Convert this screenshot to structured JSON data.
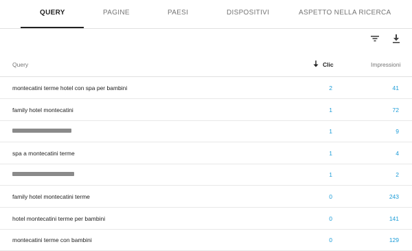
{
  "tabs": [
    {
      "label": "QUERY",
      "active": true
    },
    {
      "label": "PAGINE",
      "active": false
    },
    {
      "label": "PAESI",
      "active": false
    },
    {
      "label": "DISPOSITIVI",
      "active": false
    },
    {
      "label": "ASPETTO NELLA RICERCA",
      "active": false
    }
  ],
  "toolbar": {
    "filter_icon": "filter-icon",
    "download_icon": "download-icon"
  },
  "table": {
    "headers": {
      "query": "Query",
      "clicks": "Clic",
      "impressions": "Impressioni"
    },
    "sort": {
      "column": "Clic",
      "direction": "descending"
    },
    "rows": [
      {
        "query": "montecatini terme hotel con spa per bambini",
        "clicks": "2",
        "impressions": "41",
        "redacted": false
      },
      {
        "query": "family hotel montecatini",
        "clicks": "1",
        "impressions": "72",
        "redacted": false
      },
      {
        "query": "",
        "clicks": "1",
        "impressions": "9",
        "redacted": true
      },
      {
        "query": "spa a montecatini terme",
        "clicks": "1",
        "impressions": "4",
        "redacted": false
      },
      {
        "query": "",
        "clicks": "1",
        "impressions": "2",
        "redacted": true
      },
      {
        "query": "family hotel montecatini terme",
        "clicks": "0",
        "impressions": "243",
        "redacted": false
      },
      {
        "query": "hotel montecatini terme per bambini",
        "clicks": "0",
        "impressions": "141",
        "redacted": false
      },
      {
        "query": "montecatini terme con bambini",
        "clicks": "0",
        "impressions": "129",
        "redacted": false
      }
    ]
  },
  "colors": {
    "link": "#1a9bd7",
    "active_tab": "#212121",
    "muted": "#757575"
  }
}
